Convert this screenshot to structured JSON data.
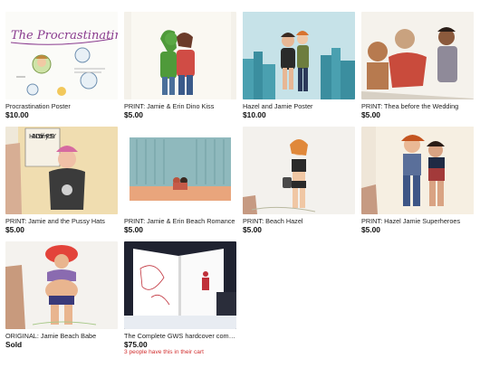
{
  "listings": [
    {
      "title": "Procrastination Poster",
      "price": "$10.00",
      "image_text": "The Procrastinating"
    },
    {
      "title": "PRINT: Jamie & Erin Dino Kiss",
      "price": "$5.00"
    },
    {
      "title": "Hazel and Jamie Poster",
      "price": "$10.00"
    },
    {
      "title": "PRINT: Thea before the Wedding",
      "price": "$5.00"
    },
    {
      "title": "PRINT: Jamie and the Pussy Hats",
      "price": "$5.00",
      "image_text": "HANDS off my PUSSY"
    },
    {
      "title": "PRINT: Jamie & Erin Beach Romance",
      "price": "$5.00"
    },
    {
      "title": "PRINT: Beach Hazel",
      "price": "$5.00"
    },
    {
      "title": "PRINT: Hazel Jamie Superheroes",
      "price": "$5.00"
    },
    {
      "title": "ORIGINAL: Jamie Beach Babe",
      "price": "Sold"
    },
    {
      "title": "The Complete GWS hardcover compen...",
      "price": "$75.00",
      "note": "3 people have this in their cart"
    }
  ]
}
